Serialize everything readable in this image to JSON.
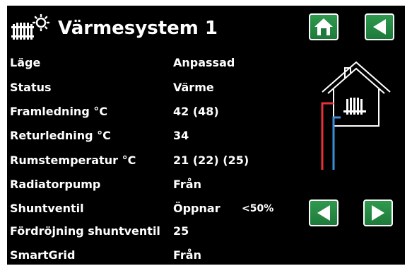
{
  "header": {
    "title": "Värmesystem 1",
    "icon": "radiator-sun-icon"
  },
  "nav": {
    "home_icon": "home-icon",
    "back_icon": "back-arrow-icon",
    "prev_icon": "previous-arrow-icon",
    "next_icon": "next-arrow-icon"
  },
  "rows": [
    {
      "label": "Läge",
      "value": "Anpassad"
    },
    {
      "label": "Status",
      "value": "Värme"
    },
    {
      "label": "Framledning °C",
      "value": "42 (48)"
    },
    {
      "label": "Returledning °C",
      "value": "34"
    },
    {
      "label": "Rumstemperatur °C",
      "value": "21 (22) (25)"
    },
    {
      "label": "Radiatorpump",
      "value": "Från"
    },
    {
      "label": "Shuntventil",
      "value": "Öppnar",
      "extra": "<50%"
    },
    {
      "label": "Fördröjning shuntventil",
      "value": "25"
    },
    {
      "label": "SmartGrid",
      "value": "Från"
    }
  ],
  "illustration": {
    "icon": "house-radiator-icon",
    "supply_color": "#e8303a",
    "return_color": "#3a8fd8"
  },
  "colors": {
    "background": "#000000",
    "text": "#ffffff",
    "button": "#1e7a3a"
  }
}
